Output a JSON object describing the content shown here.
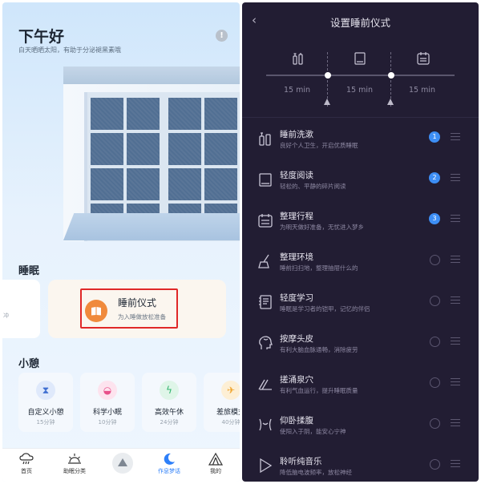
{
  "left": {
    "greeting": "下午好",
    "subtitle": "白天晒晒太阳，有助于分泌褪黑素哦",
    "info_icon": "info-icon",
    "sleep_section": "睡眠",
    "partial_card_text": "冲",
    "ritual_card": {
      "title": "睡前仪式",
      "subtitle": "为入睡做放松准备",
      "icon": "book-icon",
      "accent": "#f08a3c"
    },
    "nap_section": "小憩",
    "naps": [
      {
        "name": "自定义小憩",
        "duration": "15分钟",
        "icon": "hourglass-icon",
        "color": "#3f6fd1",
        "bg": "#dfe9fb"
      },
      {
        "name": "科学小眠",
        "duration": "10分钟",
        "icon": "basket-icon",
        "color": "#e8508a",
        "bg": "#fde3ee"
      },
      {
        "name": "高效午休",
        "duration": "24分钟",
        "icon": "lightning-icon",
        "color": "#2eb36b",
        "bg": "#dff5e8"
      },
      {
        "name": "差旅模式",
        "duration": "40分钟",
        "icon": "airplane-icon",
        "color": "#f0a42c",
        "bg": "#fdefd5"
      }
    ],
    "tabs": [
      {
        "label": "首页",
        "icon": "cloud-rain-icon"
      },
      {
        "label": "助眠分类",
        "icon": "sunrise-icon"
      },
      {
        "label": "作息梦话",
        "icon": "moon-icon",
        "active": true
      },
      {
        "label": "我的",
        "icon": "tent-icon"
      }
    ]
  },
  "right": {
    "title": "设置睡前仪式",
    "timeline": {
      "icons": [
        "toiletries-icon",
        "book-icon",
        "calendar-icon"
      ],
      "durations": [
        "15 min",
        "15 min",
        "15 min"
      ]
    },
    "items": [
      {
        "name": "睡前洗漱",
        "desc": "良好个人卫生，开启优质睡眠",
        "order": "1",
        "icon": "toiletries-icon"
      },
      {
        "name": "轻度阅读",
        "desc": "轻松的、平静的碎片阅读",
        "order": "2",
        "icon": "book-icon"
      },
      {
        "name": "整理行程",
        "desc": "为明天做好准备，无忧进入梦乡",
        "order": "3",
        "icon": "calendar-icon"
      },
      {
        "name": "整理环境",
        "desc": "睡前扫扫地，整理抽屉什么的",
        "order": null,
        "icon": "broom-icon"
      },
      {
        "name": "轻度学习",
        "desc": "睡眠是学习者的铠甲，记忆的伴侣",
        "order": null,
        "icon": "notebook-icon"
      },
      {
        "name": "按摩头皮",
        "desc": "有利大脑血脉通畅，消除疲劳",
        "order": null,
        "icon": "head-icon"
      },
      {
        "name": "搓涌泉穴",
        "desc": "有利气血运行，提升睡眠质量",
        "order": null,
        "icon": "foot-icon"
      },
      {
        "name": "仰卧揉腹",
        "desc": "使阳入于阴，能安心宁神",
        "order": null,
        "icon": "belly-icon"
      },
      {
        "name": "聆听纯音乐",
        "desc": "降低脑电波频率，放松神经",
        "order": null,
        "icon": "music-icon"
      }
    ]
  }
}
